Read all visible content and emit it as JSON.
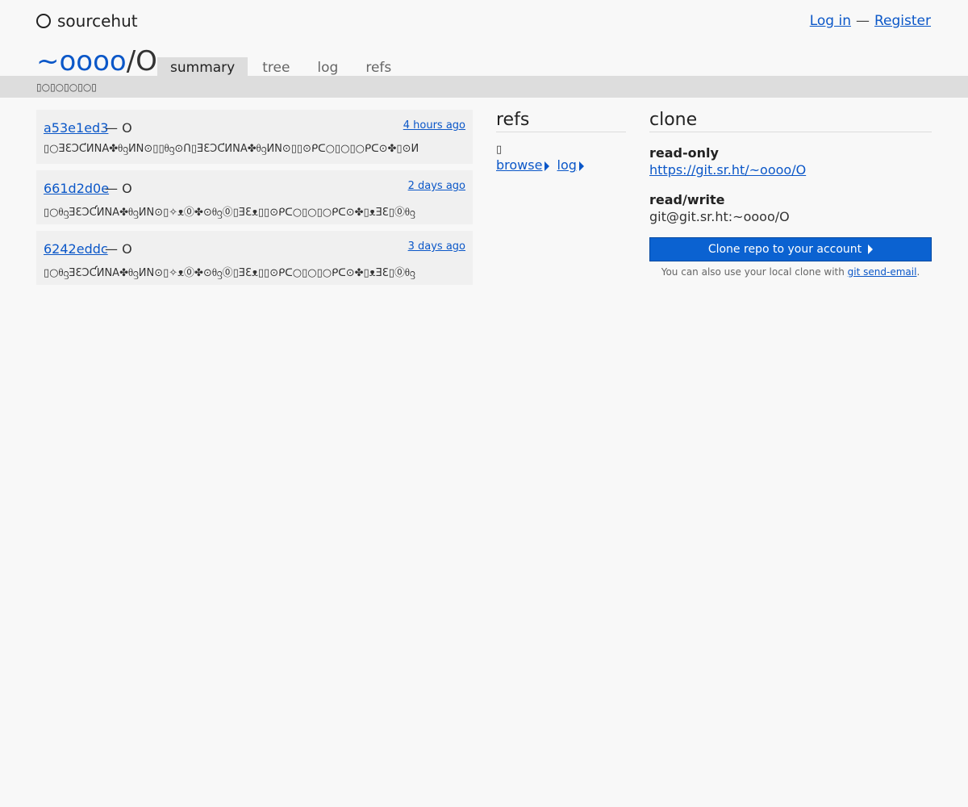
{
  "nav": {
    "brand": "sourcehut",
    "login": "Log in",
    "separator": "—",
    "register": "Register"
  },
  "repo": {
    "owner": "~oooo",
    "slash": "/",
    "name": "O",
    "description": "▯○▯○▯○▯○▯",
    "tabs": [
      "summary",
      "tree",
      "log",
      "refs"
    ],
    "active_tab": "summary"
  },
  "commits": [
    {
      "hash": "a53e1ed3",
      "author": "— O",
      "time": "4 hours ago",
      "message": "▯○ƎƐƆƇИΝА✤ᦲᦋИΝ⊙▯▯ᦲᦋ⊙Ո▯ƎƐƆƇИΝА✤ᦲᦋИΝ⊙▯▯⊙ᑭᑕ○▯○▯○ᑭᑕ⊙✤▯⊙И"
    },
    {
      "hash": "661d2d0e",
      "author": "— O",
      "time": "2 days ago",
      "message": "▯○ᦲᦋƎƐƆƇИΝА✤ᦲᦋИΝ⊙▯✧ᴥ⓪✤⊙ᦲᦋ⓪▯ƎƐᴥ▯▯⊙ᑭᑕ○▯○▯○ᑭᑕ⊙✤▯ᴥƎƐ▯⓪ᦲᦋ"
    },
    {
      "hash": "6242eddc",
      "author": "— O",
      "time": "3 days ago",
      "message": "▯○ᦲᦋƎƐƆƇИΝА✤ᦲᦋИΝ⊙▯✧ᴥ⓪✤⊙ᦲᦋ⓪▯ƎƐᴥ▯▯⊙ᑭᑕ○▯○▯○ᑭᑕ⊙✤▯ᴥƎƐ▯⓪ᦲᦋ"
    }
  ],
  "refs": {
    "title": "refs",
    "ref_name": "▯",
    "browse": "browse",
    "log": "log"
  },
  "clone": {
    "title": "clone",
    "ro_label": "read-only",
    "ro_url": "https://git.sr.ht/~oooo/O",
    "rw_label": "read/write",
    "rw_url": "git@git.sr.ht:~oooo/O",
    "button": "Clone repo to your account",
    "hint_prefix": "You can also use your local clone with ",
    "hint_link": "git send-email",
    "hint_suffix": "."
  }
}
